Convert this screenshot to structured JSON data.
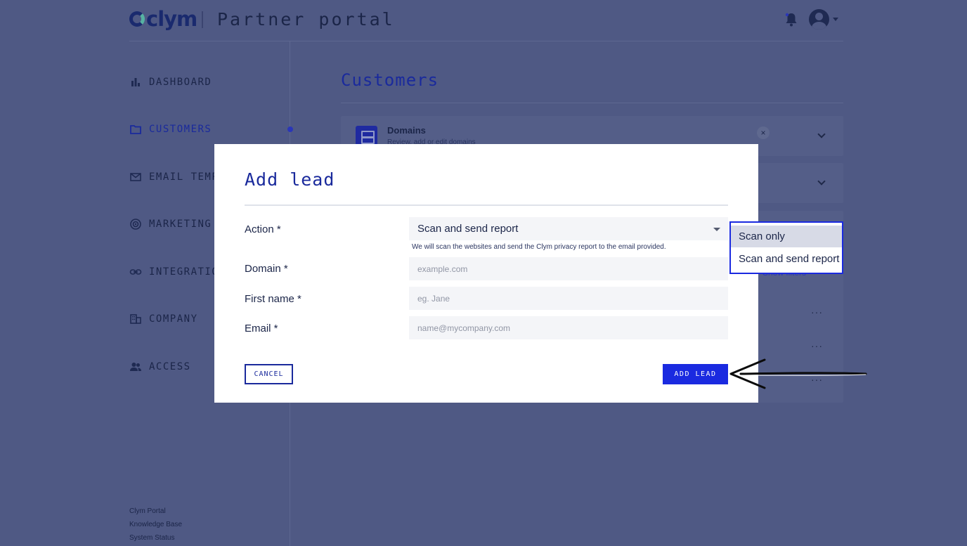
{
  "header": {
    "logo_text": "clym",
    "portal_title": "Partner portal",
    "bell_icon": "bell-icon",
    "avatar_icon": "user-avatar-icon"
  },
  "sidebar": {
    "items": [
      {
        "label": "DASHBOARD",
        "icon": "bar-chart-icon"
      },
      {
        "label": "CUSTOMERS",
        "icon": "folder-icon",
        "active": true
      },
      {
        "label": "EMAIL TEMPLATES",
        "icon": "mail-icon"
      },
      {
        "label": "MARKETING MATERIALS",
        "icon": "target-icon"
      },
      {
        "label": "INTEGRATIONS",
        "icon": "link-icon"
      },
      {
        "label": "COMPANY",
        "icon": "building-icon"
      },
      {
        "label": "ACCESS",
        "icon": "people-icon"
      }
    ],
    "footer_links": [
      "Clym Portal",
      "Knowledge Base",
      "System Status"
    ]
  },
  "main": {
    "title": "Customers",
    "domains_card": {
      "title": "Domains",
      "subtitle": "Review, add or edit domains"
    },
    "show_filters": "Show filters"
  },
  "modal": {
    "title": "Add lead",
    "fields": {
      "action": {
        "label": "Action *",
        "value": "Scan and send report",
        "helper": "We will scan the websites and send the Clym privacy report to the email provided."
      },
      "domain": {
        "label": "Domain *",
        "placeholder": "example.com"
      },
      "first_name": {
        "label": "First name *",
        "placeholder": "eg. Jane"
      },
      "email": {
        "label": "Email *",
        "placeholder": "name@mycompany.com"
      }
    },
    "cancel_label": "CANCEL",
    "add_label": "ADD LEAD"
  },
  "dropdown": {
    "options": [
      "Scan only",
      "Scan and send report"
    ],
    "highlighted": "Scan only"
  },
  "colors": {
    "brand_blue": "#1a2ae0",
    "title_blue": "#1a2a9c",
    "overlay": "#4f5984"
  }
}
